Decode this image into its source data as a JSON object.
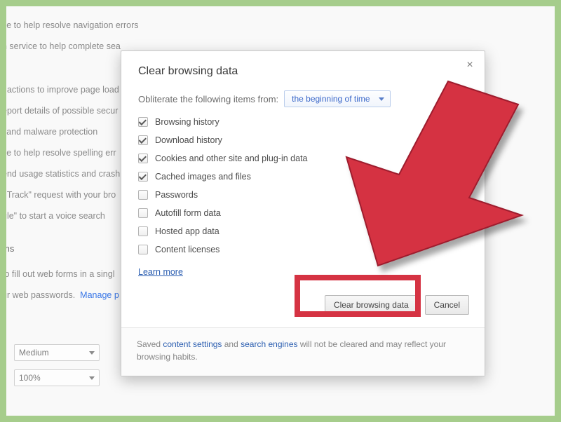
{
  "background": {
    "lines": {
      "l1": "ce to help resolve navigation errors",
      "l2": "n service to help complete sea",
      "l3": ": actions to improve page load",
      "l4": "eport details of possible secur",
      "l5": "j and malware protection",
      "l6": "ce to help resolve spelling err",
      "l7": "end usage statistics and crash",
      "l8": ": Track\" request with your bro",
      "l9": "gle\" to start a voice search",
      "heading": "ms",
      "l10": "to fill out web forms in a singl",
      "l11": "ur web passwords.",
      "manage_passwords": "Manage p"
    },
    "selects": {
      "medium": "Medium",
      "zoom": "100%"
    }
  },
  "dialog": {
    "title": "Clear browsing data",
    "obliterate_label": "Obliterate the following items from:",
    "time_range": "the beginning of time",
    "checkboxes": [
      {
        "label": "Browsing history",
        "checked": true
      },
      {
        "label": "Download history",
        "checked": true
      },
      {
        "label": "Cookies and other site and plug-in data",
        "checked": true
      },
      {
        "label": "Cached images and files",
        "checked": true
      },
      {
        "label": "Passwords",
        "checked": false
      },
      {
        "label": "Autofill form data",
        "checked": false
      },
      {
        "label": "Hosted app data",
        "checked": false
      },
      {
        "label": "Content licenses",
        "checked": false
      }
    ],
    "learn_more": "Learn more",
    "clear_button": "Clear browsing data",
    "cancel_button": "Cancel",
    "footer": {
      "t1": "Saved ",
      "link1": "content settings",
      "t2": " and ",
      "link2": "search engines",
      "t3": " will not be cleared and may reflect your browsing habits."
    }
  },
  "annotation": {
    "arrow_color": "#d53343"
  }
}
